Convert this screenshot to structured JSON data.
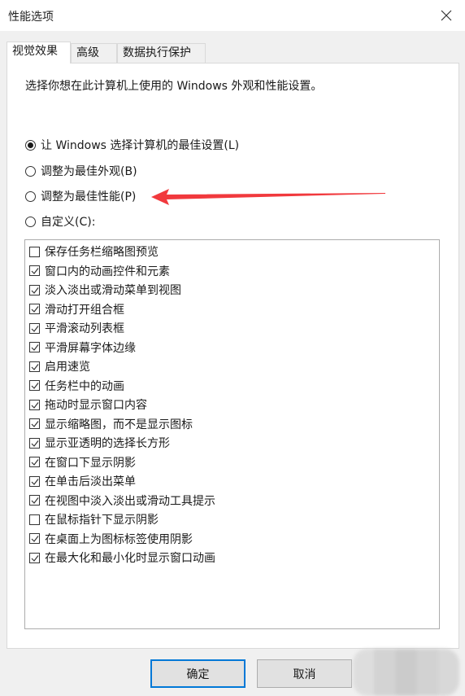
{
  "window": {
    "title": "性能选项",
    "close_icon": "close-icon"
  },
  "tabs": [
    {
      "label": "视觉效果",
      "active": true
    },
    {
      "label": "高级",
      "active": false
    },
    {
      "label": "数据执行保护",
      "active": false
    }
  ],
  "description": "选择你想在此计算机上使用的 Windows 外观和性能设置。",
  "radios": [
    {
      "label": "让 Windows 选择计算机的最佳设置(L)",
      "selected": true
    },
    {
      "label": "调整为最佳外观(B)",
      "selected": false
    },
    {
      "label": "调整为最佳性能(P)",
      "selected": false
    },
    {
      "label": "自定义(C):",
      "selected": false
    }
  ],
  "annotation": {
    "type": "arrow",
    "color": "#f0282c",
    "points_to": "调整为最佳性能(P)"
  },
  "checkboxes": [
    {
      "label": "保存任务栏缩略图预览",
      "checked": false
    },
    {
      "label": "窗口内的动画控件和元素",
      "checked": true
    },
    {
      "label": "淡入淡出或滑动菜单到视图",
      "checked": true
    },
    {
      "label": "滑动打开组合框",
      "checked": true
    },
    {
      "label": "平滑滚动列表框",
      "checked": true
    },
    {
      "label": "平滑屏幕字体边缘",
      "checked": true
    },
    {
      "label": "启用速览",
      "checked": true
    },
    {
      "label": "任务栏中的动画",
      "checked": true
    },
    {
      "label": "拖动时显示窗口内容",
      "checked": true
    },
    {
      "label": "显示缩略图，而不是显示图标",
      "checked": true
    },
    {
      "label": "显示亚透明的选择长方形",
      "checked": true
    },
    {
      "label": "在窗口下显示阴影",
      "checked": true
    },
    {
      "label": "在单击后淡出菜单",
      "checked": true
    },
    {
      "label": "在视图中淡入淡出或滑动工具提示",
      "checked": true
    },
    {
      "label": "在鼠标指针下显示阴影",
      "checked": false
    },
    {
      "label": "在桌面上为图标标签使用阴影",
      "checked": true
    },
    {
      "label": "在最大化和最小化时显示窗口动画",
      "checked": true
    }
  ],
  "buttons": {
    "ok": "确定",
    "cancel": "取消"
  },
  "colors": {
    "default_button_border": "#0078d7",
    "arrow": "#f0282c"
  }
}
